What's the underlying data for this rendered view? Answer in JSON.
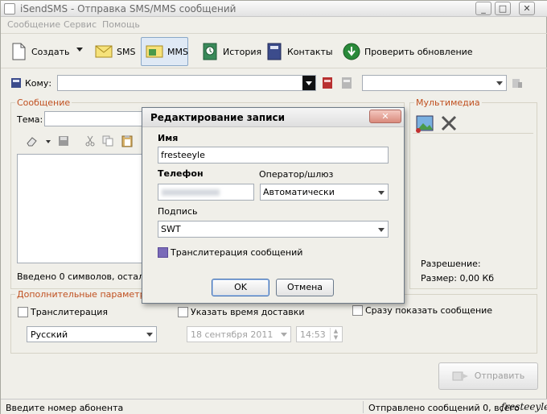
{
  "window": {
    "title": "iSendSMS - Отправка SMS/MMS сообщений",
    "buttons": {
      "minimize": "_",
      "maximize": "□",
      "close": "✕"
    }
  },
  "menu": [
    "Сообщение",
    "Сервис",
    "Помощь"
  ],
  "toolbar": {
    "create": "Создать",
    "sms": "SMS",
    "mms": "MMS",
    "history": "История",
    "contacts": "Контакты",
    "check_update": "Проверить обновление"
  },
  "to": {
    "label": "Кому:",
    "value": ""
  },
  "message_group": {
    "title": "Сообщение",
    "subject_label": "Тема:",
    "counter": "Введено 0 символов, осталось"
  },
  "multimedia": {
    "title": "Мультимедиа",
    "resolution_label": "Разрешение:",
    "size_label": "Размер: 0,00 Кб"
  },
  "extra": {
    "title": "Дополнительные параметры",
    "translit": "Транслитерация",
    "language": "Русский",
    "delivery_time": "Указать время доставки",
    "date": "18 сентября 2011",
    "time": "14:53",
    "flash": "Сразу показать сообщение"
  },
  "send_button": "Отправить",
  "status": {
    "left": "Введите номер абонента",
    "right": "Отправлено сообщений 0, всего",
    "watermark": "fresteeyle"
  },
  "dialog": {
    "title": "Редактирование записи",
    "name_label": "Имя",
    "name_value": "fresteeyle",
    "phone_label": "Телефон",
    "operator_label": "Оператор/шлюз",
    "operator_value": "Автоматически",
    "signature_label": "Подпись",
    "signature_value": "SWT",
    "translit_label": "Транслитерация сообщений",
    "ok": "OK",
    "cancel": "Отмена"
  },
  "colors": {
    "accent_label": "#c05020",
    "window_bg": "#f0efe9"
  }
}
